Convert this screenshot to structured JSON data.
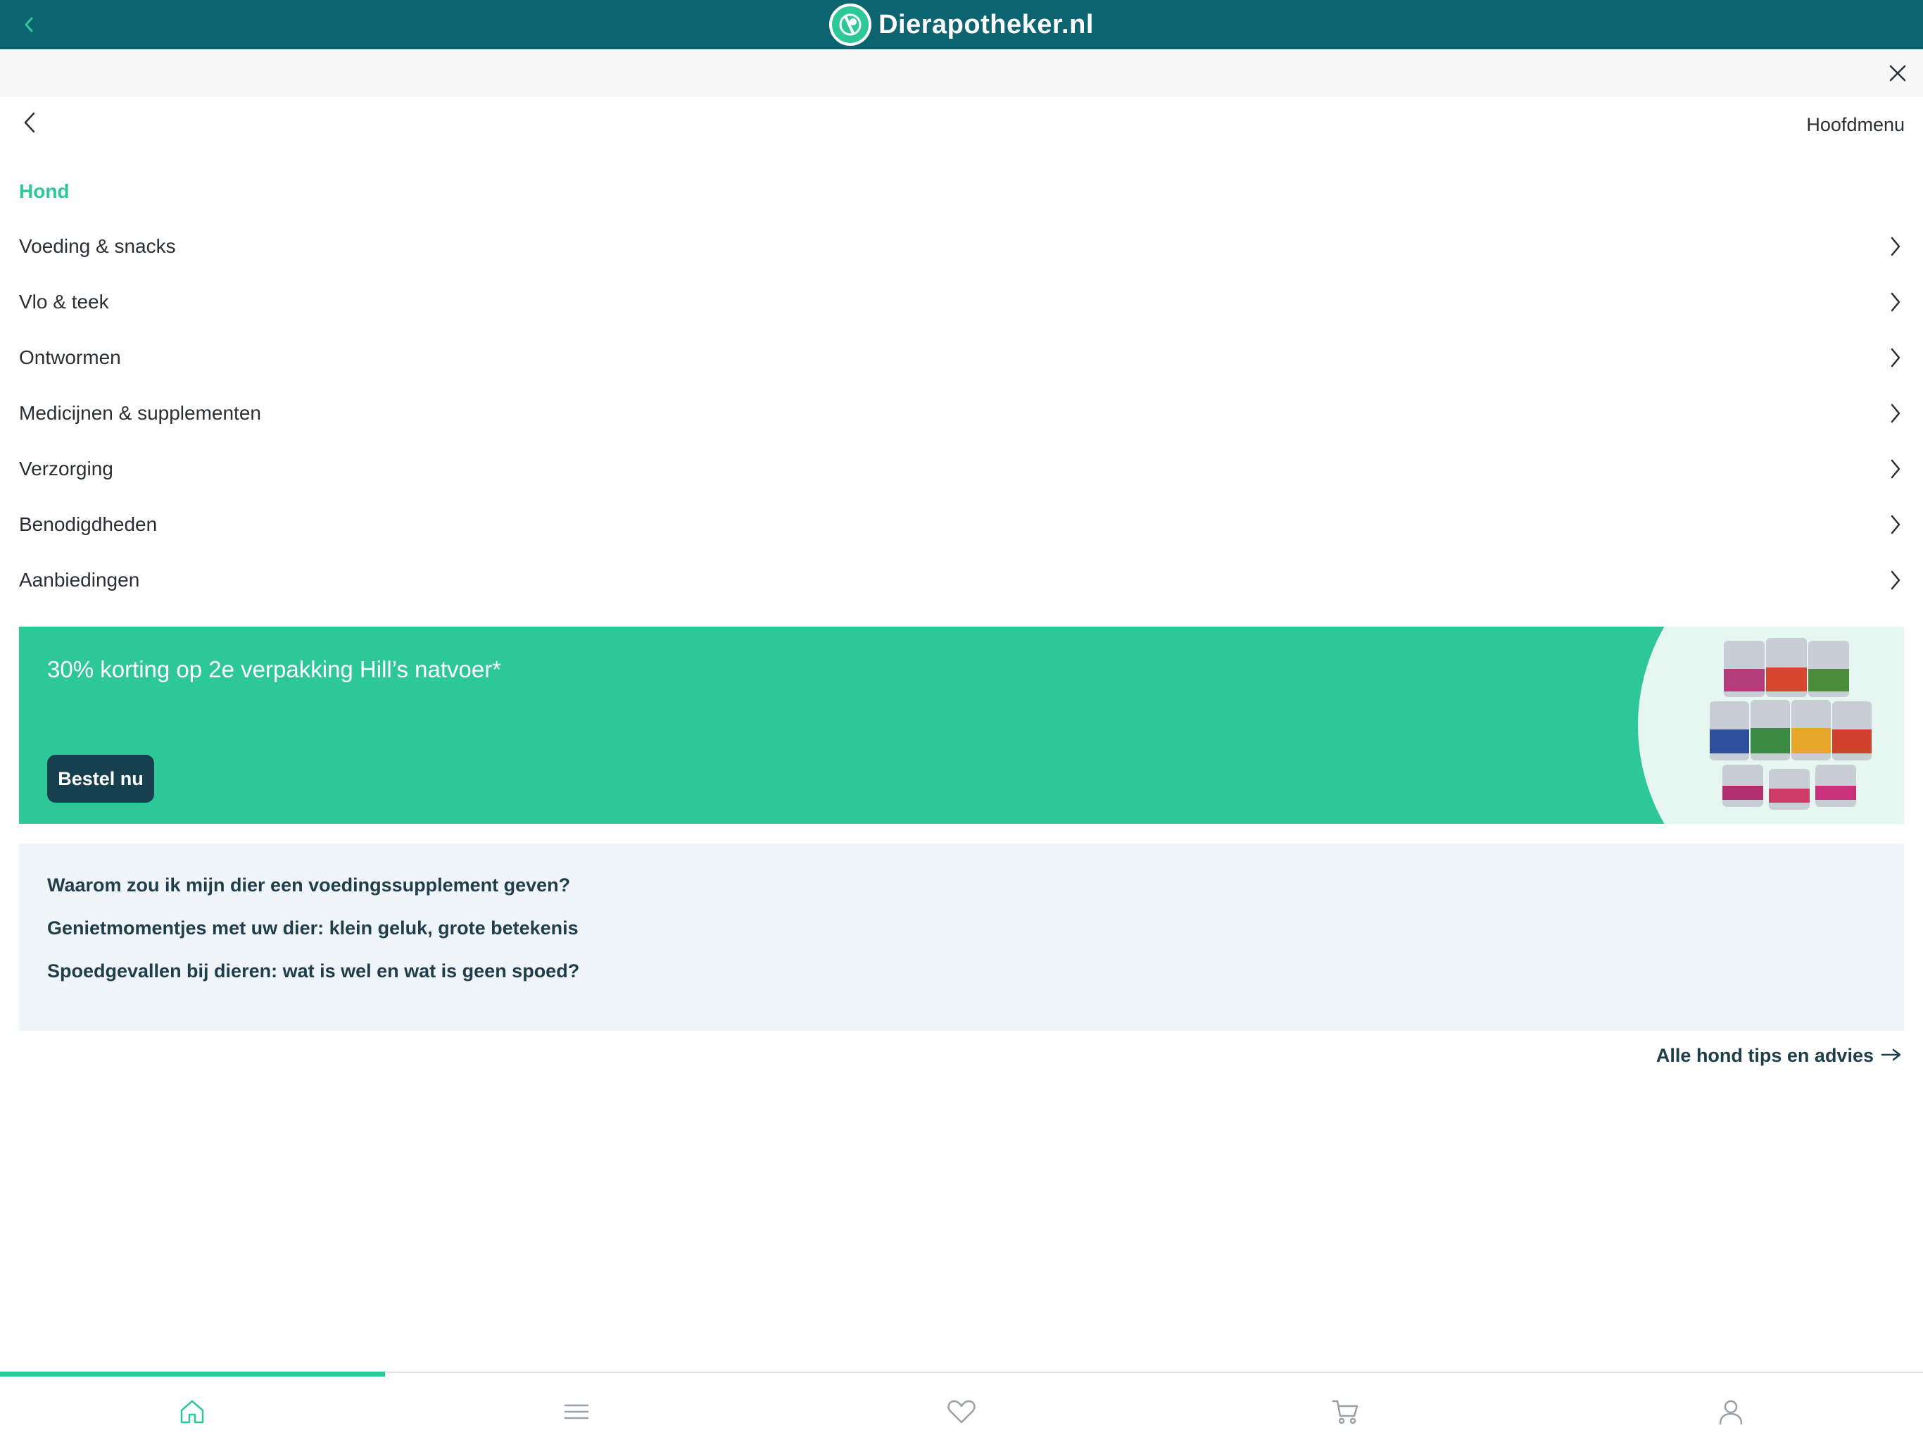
{
  "header": {
    "brand": "Dierapotheker.nl",
    "back_icon": "chevron-left-icon",
    "logo_icon": "pet-logo-icon",
    "colors": {
      "bar": "#0d6471",
      "accent": "#2ec898"
    }
  },
  "subbar": {
    "close_icon": "close-icon"
  },
  "menu": {
    "back_icon": "chevron-left-icon",
    "main_menu_label": "Hoofdmenu",
    "section_title": "Hond",
    "items": [
      {
        "label": "Voeding & snacks"
      },
      {
        "label": "Vlo & teek"
      },
      {
        "label": "Ontwormen"
      },
      {
        "label": "Medicijnen & supplementen"
      },
      {
        "label": "Verzorging"
      },
      {
        "label": "Benodigdheden"
      },
      {
        "label": "Aanbiedingen"
      }
    ]
  },
  "promo": {
    "text": "30% korting op 2e verpakking Hill’s natvoer*",
    "button": "Bestel nu",
    "colors": {
      "background": "#2ec898",
      "button": "#17404f"
    }
  },
  "articles": {
    "items": [
      "Waarom zou ik mijn dier een voedingssupplement geven?",
      "Genietmomentjes met uw dier: klein geluk, grote betekenis",
      "Spoedgevallen bij dieren: wat is wel en wat is geen spoed?"
    ],
    "all_link": "Alle hond tips en advies"
  },
  "bottom_nav": {
    "items": [
      {
        "icon": "home-icon",
        "active": true
      },
      {
        "icon": "menu-icon",
        "active": false
      },
      {
        "icon": "heart-icon",
        "active": false
      },
      {
        "icon": "cart-icon",
        "active": false
      },
      {
        "icon": "user-icon",
        "active": false
      }
    ]
  }
}
